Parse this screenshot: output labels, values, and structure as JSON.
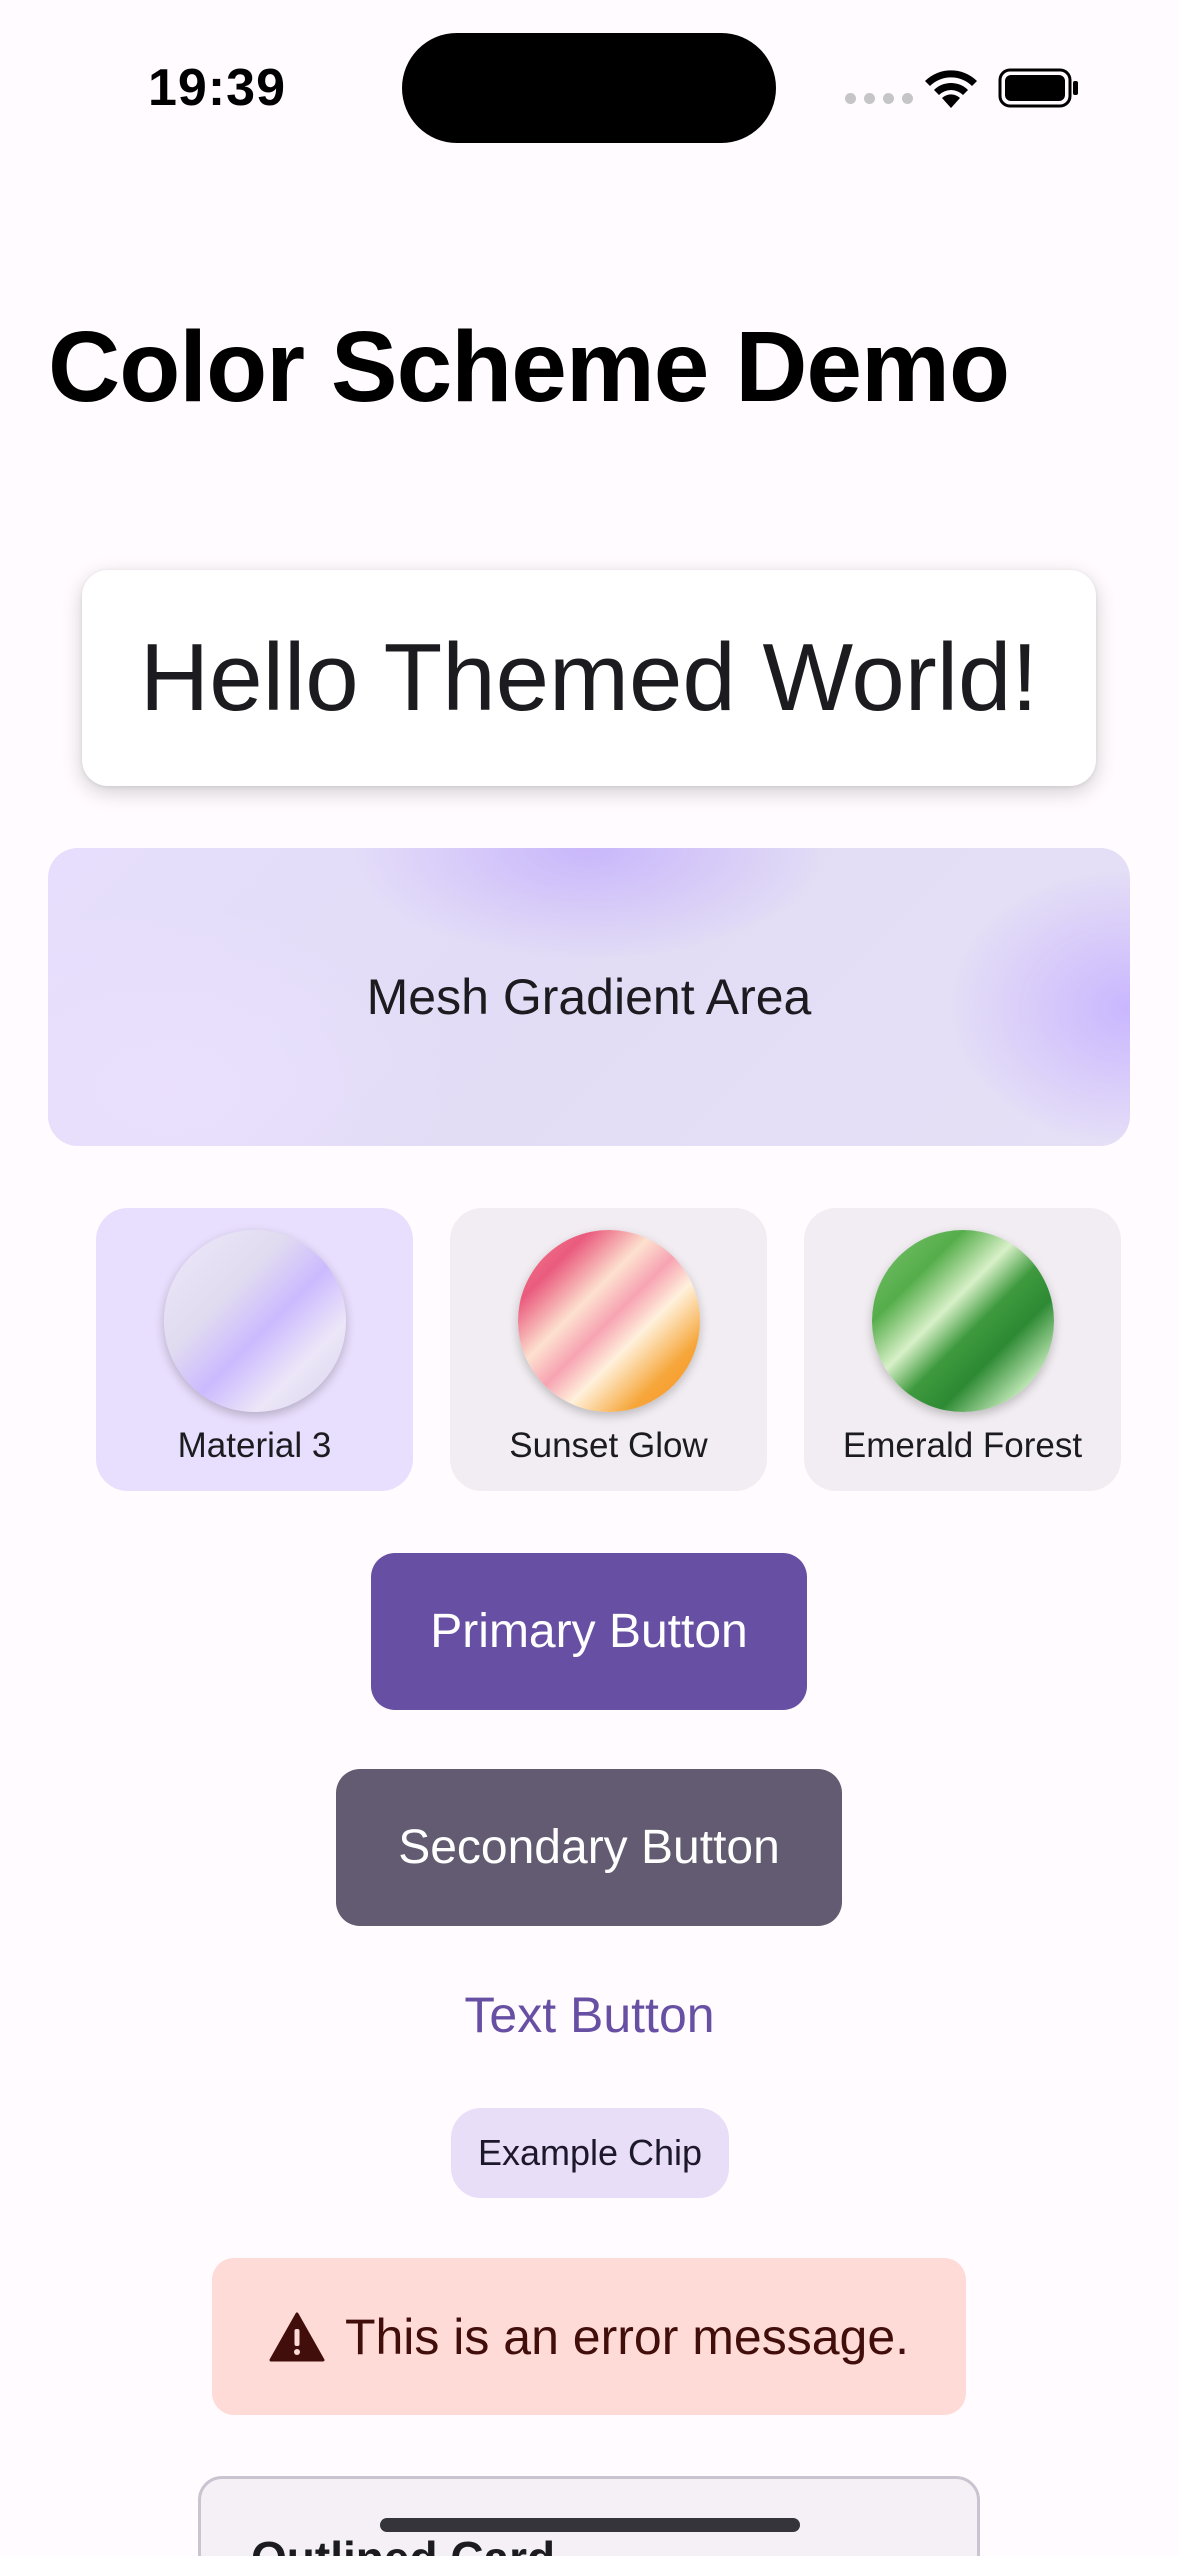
{
  "status_bar": {
    "time": "19:39",
    "icons": [
      "cellular-signal-icon",
      "wifi-icon",
      "battery-icon"
    ]
  },
  "page": {
    "title": "Color Scheme Demo"
  },
  "hello_card": {
    "text": "Hello Themed World!"
  },
  "mesh_gradient": {
    "label": "Mesh Gradient Area"
  },
  "color_schemes": {
    "selected": "Material 3",
    "items": [
      {
        "label": "Material 3",
        "colors": [
          "#efe9fb",
          "#cbbaff",
          "#d9d2ec"
        ]
      },
      {
        "label": "Sunset Glow",
        "colors": [
          "#ea5b7e",
          "#fde1cf",
          "#ff8e1e"
        ]
      },
      {
        "label": "Emerald Forest",
        "colors": [
          "#55ad4a",
          "#d8f0c8",
          "#2d8a33"
        ]
      }
    ]
  },
  "buttons": {
    "primary_label": "Primary Button",
    "secondary_label": "Secondary Button",
    "text_label": "Text Button"
  },
  "chip": {
    "label": "Example Chip"
  },
  "error": {
    "icon": "warning-icon",
    "message": "This is an error message."
  },
  "outlined_card": {
    "title": "Outlined Card"
  },
  "colors": {
    "primary": "#6750a4",
    "secondary": "#625b71",
    "background": "#fffbfe",
    "error_container": "#fedbd6",
    "on_error_container": "#410e0b",
    "chip_background": "#e8def8"
  }
}
